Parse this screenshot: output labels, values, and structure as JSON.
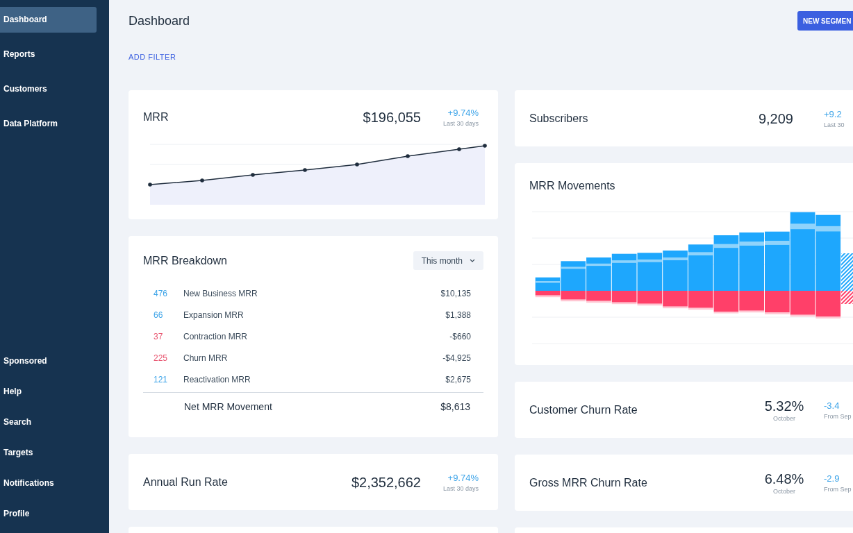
{
  "sidebar": {
    "top_items": [
      {
        "label": "Dashboard",
        "selected": true
      },
      {
        "label": "Reports",
        "selected": false
      },
      {
        "label": "Customers",
        "selected": false
      },
      {
        "label": "Data Platform",
        "selected": false
      }
    ],
    "bottom_items": [
      {
        "label": "Sponsored",
        "selected": false
      },
      {
        "label": "Help",
        "selected": false
      },
      {
        "label": "Search",
        "selected": false
      },
      {
        "label": "Targets",
        "selected": false
      },
      {
        "label": "Notifications",
        "selected": false
      },
      {
        "label": "Profile",
        "selected": false
      }
    ]
  },
  "header": {
    "title": "Dashboard",
    "button": "NEW SEGMEN",
    "add_filter": "ADD FILTER"
  },
  "left_column": [
    {
      "kind": "line",
      "title": "MRR",
      "value": "$196,055",
      "delta": "+9.74%",
      "delta_note": "Last 30 days"
    },
    {
      "kind": "breakdown",
      "title": "MRR Breakdown",
      "period": "This month",
      "rows": [
        {
          "count": "476",
          "label": "New Business MRR",
          "value": "$10,135",
          "color": "#3ba3e8"
        },
        {
          "count": "66",
          "label": "Expansion MRR",
          "value": "$1,388",
          "color": "#3ba3e8"
        },
        {
          "count": "37",
          "label": "Contraction MRR",
          "value": "-$660",
          "color": "#e8546f"
        },
        {
          "count": "225",
          "label": "Churn MRR",
          "value": "-$4,925",
          "color": "#e8546f"
        },
        {
          "count": "121",
          "label": "Reactivation MRR",
          "value": "$2,675",
          "color": "#3ba3e8"
        }
      ],
      "total": {
        "label": "Net MRR Movement",
        "value": "$8,613"
      }
    },
    {
      "kind": "metric",
      "title": "Annual Run Rate",
      "value": "$2,352,662",
      "delta": "+9.74%",
      "delta_note": "Last 30 days"
    }
  ],
  "right_column": [
    {
      "kind": "metric",
      "title": "Subscribers",
      "value": "9,209",
      "delta": "+9.2",
      "delta_note": "Last 30"
    },
    {
      "kind": "bars",
      "title": "MRR Movements"
    },
    {
      "kind": "rate",
      "title": "Customer Churn Rate",
      "value": "5.32%",
      "value_note": "October",
      "delta": "-3.4",
      "delta_note": "From Sep"
    },
    {
      "kind": "rate",
      "title": "Gross MRR Churn Rate",
      "value": "6.48%",
      "value_note": "October",
      "delta": "-2.9",
      "delta_note": "From Sep"
    }
  ]
}
